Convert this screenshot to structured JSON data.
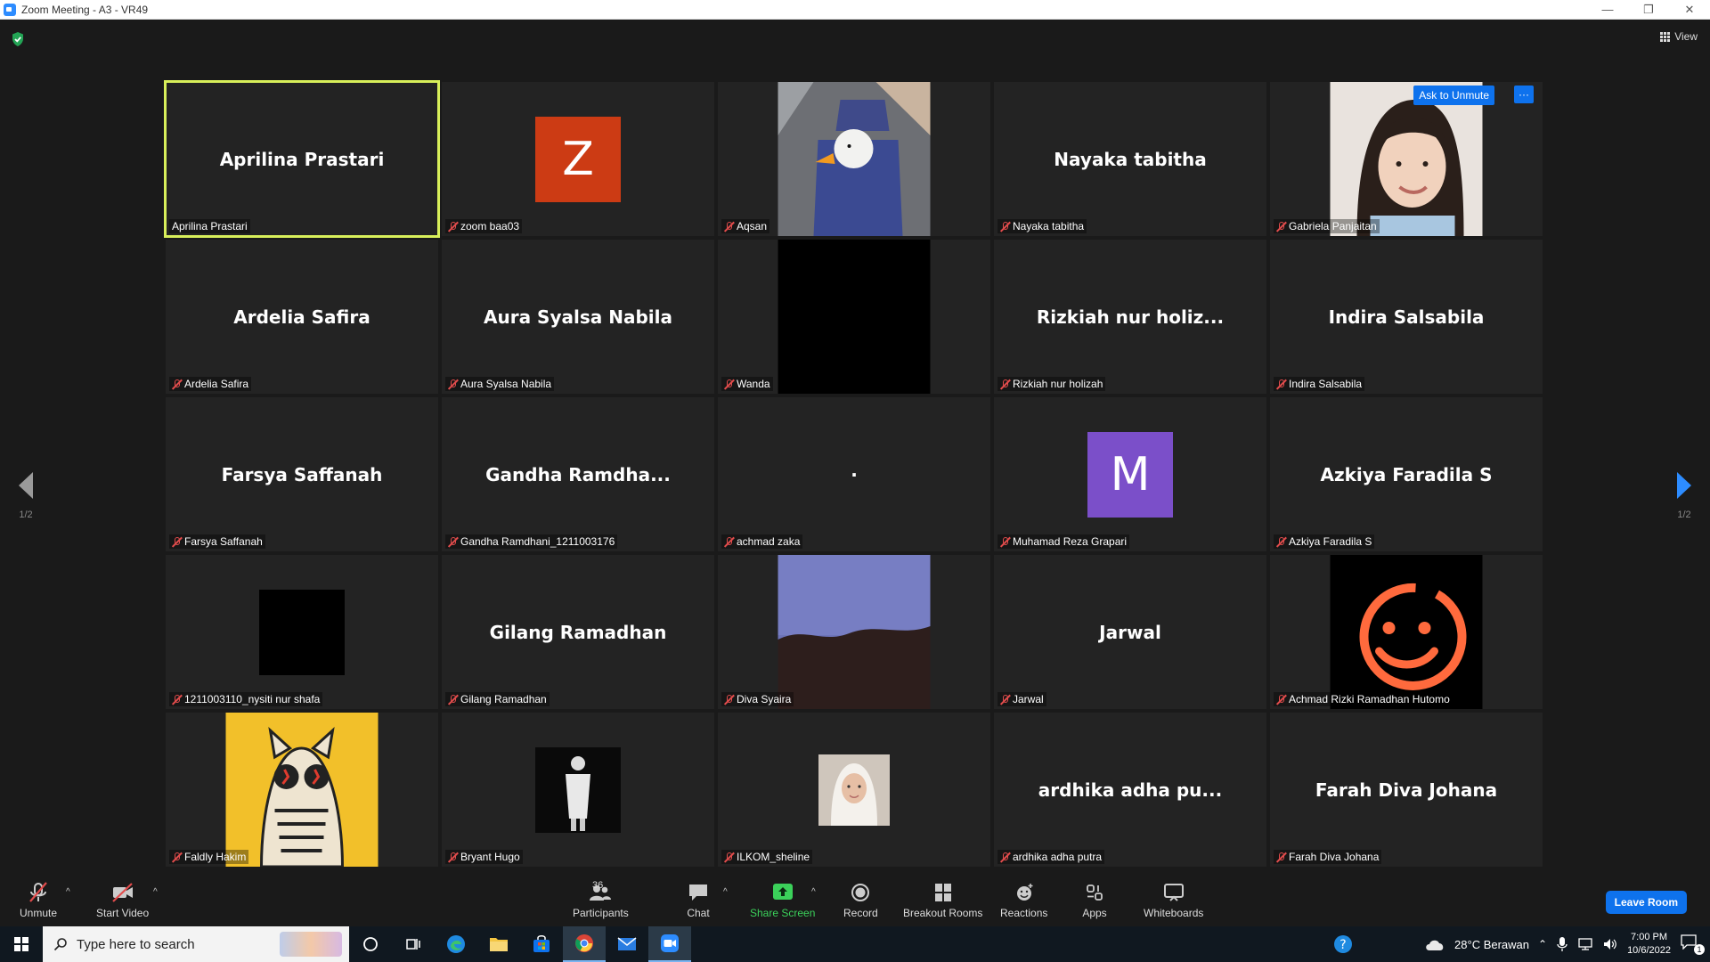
{
  "window": {
    "title": "Zoom Meeting - A3 - VR49",
    "minimize": "—",
    "restore": "❐",
    "close": "✕"
  },
  "topbar": {
    "view_label": "View"
  },
  "nav": {
    "prev_page": "1/2",
    "next_page": "1/2"
  },
  "tiles": [
    {
      "big": "Aprilina Prastari",
      "label": "Aprilina Prastari",
      "muted": false,
      "active": true
    },
    {
      "avatar_letter": "Z",
      "avatar_color": "#cc3b14",
      "label": "zoom baa03",
      "muted": true
    },
    {
      "pic": "duck-in-bag-photo",
      "label": "Aqsan",
      "muted": true
    },
    {
      "big": "Nayaka tabitha",
      "label": "Nayaka tabitha",
      "muted": true
    },
    {
      "pic": "woman-portrait-photo",
      "label": "Gabriela Panjaitan",
      "muted": true,
      "ask_unmute": "Ask to Unmute",
      "more": "···"
    },
    {
      "big": "Ardelia Safira",
      "label": "Ardelia Safira",
      "muted": true
    },
    {
      "big": "Aura Syalsa Nabila",
      "label": "Aura Syalsa Nabila",
      "muted": true
    },
    {
      "pic": "black-video",
      "label": "Wanda",
      "muted": true
    },
    {
      "big": "Rizkiah nur holiz...",
      "label": "Rizkiah nur holizah",
      "muted": true
    },
    {
      "big": "Indira Salsabila",
      "label": "Indira Salsabila",
      "muted": true
    },
    {
      "big": "Farsya Saffanah",
      "label": "Farsya Saffanah",
      "muted": true
    },
    {
      "big": "Gandha Ramdha...",
      "label": "Gandha Ramdhani_1211003176",
      "muted": true
    },
    {
      "big": "·",
      "label": "achmad zaka",
      "muted": true
    },
    {
      "avatar_letter": "M",
      "avatar_color": "#7b4fc9",
      "label": "Muhamad Reza Grapari",
      "muted": true
    },
    {
      "big": "Azkiya Faradila S",
      "label": "Azkiya Faradila S",
      "muted": true
    },
    {
      "pic": "black-square",
      "label": "1211003110_nysiti nur shafa",
      "muted": true
    },
    {
      "big": "Gilang Ramadhan",
      "label": "Gilang Ramadhan",
      "muted": true
    },
    {
      "pic": "blue-sky-texture",
      "label": "Diva Syaira",
      "muted": true
    },
    {
      "big": "Jarwal",
      "label": "Jarwal",
      "muted": true
    },
    {
      "pic": "orange-smiley-icon",
      "label": "Achmad Rizki Ramadhan Hutomo",
      "muted": true
    },
    {
      "pic": "cat-sunglasses-art",
      "label": "Faldly Hakim",
      "muted": true
    },
    {
      "pic": "person-dark-photo",
      "label": "Bryant Hugo",
      "muted": true
    },
    {
      "pic": "hijab-portrait-photo",
      "label": "ILKOM_sheline",
      "muted": true
    },
    {
      "big": "ardhika adha pu...",
      "label": "ardhika adha putra",
      "muted": true
    },
    {
      "big": "Farah Diva Johana",
      "label": "Farah Diva Johana",
      "muted": true
    }
  ],
  "toolbar": {
    "unmute": "Unmute",
    "start_video": "Start Video",
    "participants": "Participants",
    "participants_count": "36",
    "chat": "Chat",
    "share_screen": "Share Screen",
    "record": "Record",
    "breakout_rooms": "Breakout Rooms",
    "reactions": "Reactions",
    "apps": "Apps",
    "whiteboards": "Whiteboards",
    "leave": "Leave Room",
    "caret": "^"
  },
  "taskbar": {
    "search_placeholder": "Type here to search",
    "weather": "28°C  Berawan",
    "time": "7:00 PM",
    "date": "10/6/2022",
    "notification_count": "1"
  },
  "colors": {
    "accent": "#0e72ed",
    "active_speaker": "#d8ef5a",
    "share_green": "#3bd15a",
    "mute_red": "#e24c4c"
  }
}
